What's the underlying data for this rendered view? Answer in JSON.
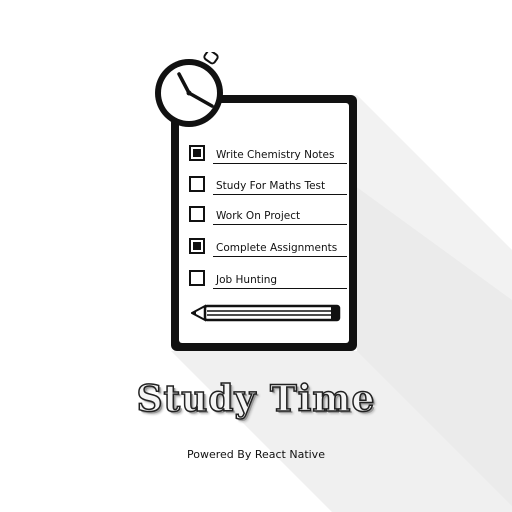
{
  "tasks": [
    {
      "label": "Write Chemistry Notes",
      "checked": true
    },
    {
      "label": "Study For Maths Test",
      "checked": false
    },
    {
      "label": "Work On Project",
      "checked": false
    },
    {
      "label": "Complete Assignments",
      "checked": true
    },
    {
      "label": "Job Hunting",
      "checked": false
    }
  ],
  "app_title": "Study Time",
  "powered_by": "Powered By React Native",
  "icons": {
    "clock": "stopwatch-icon",
    "pencil": "pencil-icon"
  },
  "colors": {
    "ink": "#111111",
    "background": "#ffffff",
    "shadow": "#e6e6e6"
  }
}
